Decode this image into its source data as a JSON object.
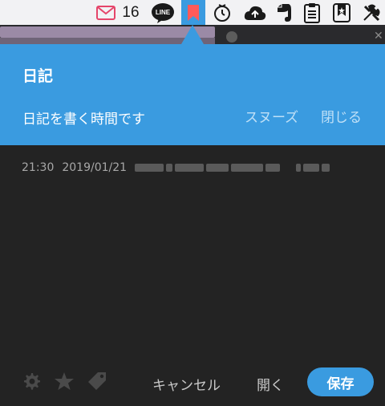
{
  "menubar": {
    "mail_count": "16",
    "line_label": "LINE"
  },
  "header": {
    "title": "日記",
    "message": "日記を書く時間です",
    "snooze_label": "スヌーズ",
    "close_label": "閉じる"
  },
  "entry": {
    "time": "21:30",
    "date": "2019/01/21"
  },
  "footer": {
    "cancel_label": "キャンセル",
    "open_label": "開く",
    "save_label": "保存"
  },
  "colors": {
    "accent": "#3a9be0",
    "content_bg": "#232323",
    "bookmark_active": "#ff5a5a"
  },
  "icons": [
    "mail-icon",
    "line-icon",
    "bookmark-icon",
    "timer-icon",
    "cloud-upload-icon",
    "evernote-icon",
    "clipboard-icon",
    "bookmark-star-icon",
    "tools-icon",
    "gear-icon",
    "star-icon",
    "tag-icon"
  ]
}
